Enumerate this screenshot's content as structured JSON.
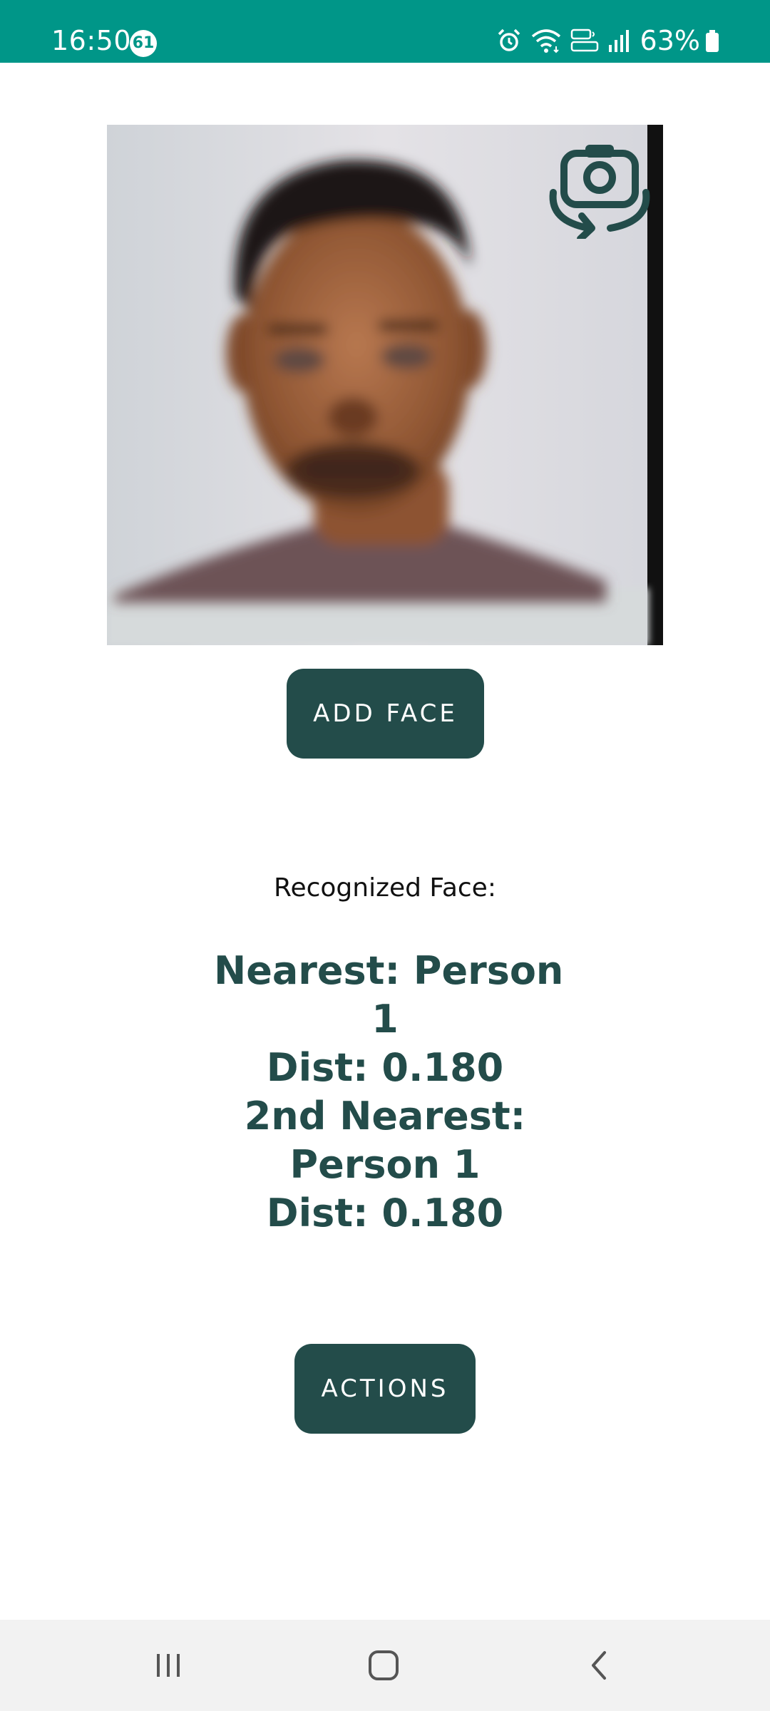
{
  "status_bar": {
    "time": "16:50",
    "notification_count": "61",
    "battery_percent": "63%",
    "background_color": "#009688",
    "icons": [
      "alarm-icon",
      "wifi-icon",
      "volte-icon",
      "signal-icon",
      "battery-icon"
    ]
  },
  "camera": {
    "switch_icon": "switch-camera-icon"
  },
  "buttons": {
    "add_face": "ADD FACE",
    "actions": "ACTIONS"
  },
  "recognition": {
    "label": "Recognized Face:",
    "lines": [
      "Nearest: Person",
      "1",
      "Dist: 0.180",
      "2nd Nearest:",
      "Person 1",
      "Dist: 0.180"
    ]
  },
  "nav": {
    "icons": [
      "recent-apps-icon",
      "home-icon",
      "back-icon"
    ]
  },
  "colors": {
    "accent": "#234c4a",
    "status_bar": "#009688",
    "nav_bar": "#f2f2f2"
  }
}
